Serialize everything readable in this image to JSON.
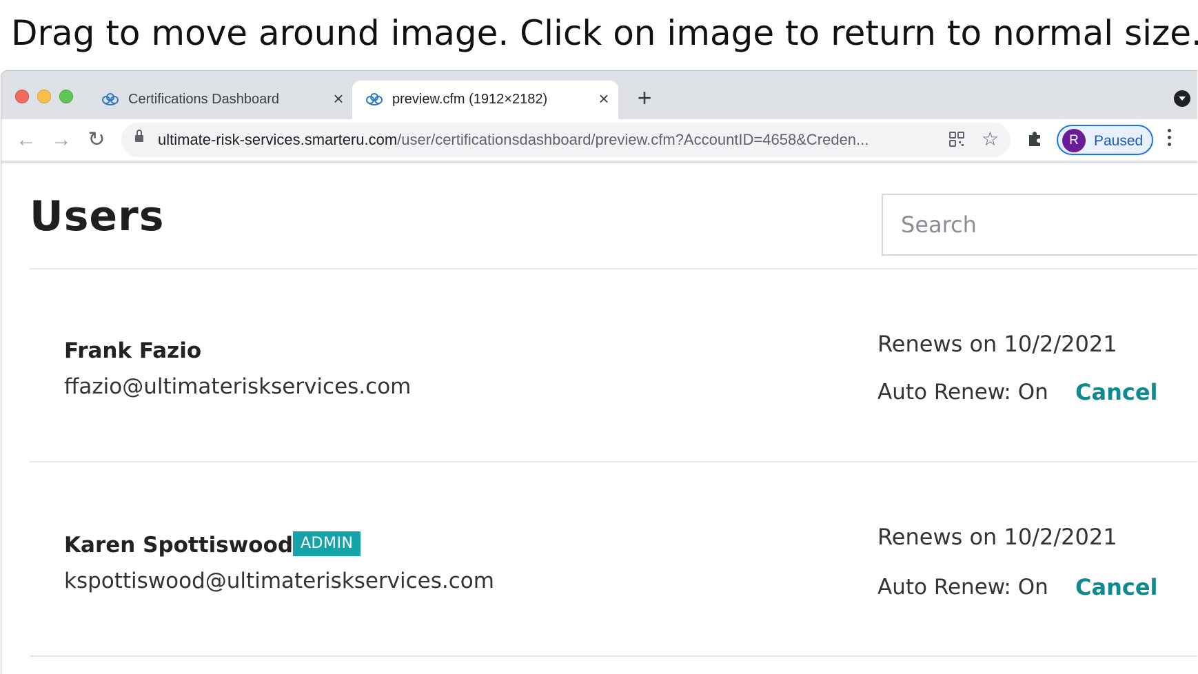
{
  "instruction": "Drag to move around image. Click on image to return to normal size.",
  "browser": {
    "tabs": [
      {
        "title": "Certifications Dashboard",
        "active": false,
        "favicon": "brain-icon"
      },
      {
        "title": "preview.cfm (1912×2182)",
        "active": true,
        "favicon": "brain-icon"
      }
    ],
    "url_host": "ultimate-risk-services.smarteru.com",
    "url_path": "/user/certificationsdashboard/preview.cfm?AccountID=4658&Creden...",
    "profile": {
      "initial": "R",
      "label": "Paused"
    },
    "colors": {
      "tabstrip": "#dee1e6",
      "profile_accent": "#1a73e8",
      "avatar": "#6a1b9a"
    }
  },
  "page": {
    "title": "Users",
    "search": {
      "placeholder": "Search",
      "value": ""
    },
    "users": [
      {
        "name": "Frank Fazio",
        "email": "ffazio@ultimateriskservices.com",
        "badge": "",
        "renews": "Renews on 10/2/2021",
        "auto_renew": "Auto Renew: On",
        "action": "Cancel"
      },
      {
        "name": "Karen Spottiswood",
        "email": "kspottiswood@ultimateriskservices.com",
        "badge": "ADMIN",
        "renews": "Renews on 10/2/2021",
        "auto_renew": "Auto Renew: On",
        "action": "Cancel"
      }
    ],
    "colors": {
      "accent": "#0f8a8f",
      "badge": "#14a3a8",
      "divider": "#e3e5e8"
    }
  }
}
